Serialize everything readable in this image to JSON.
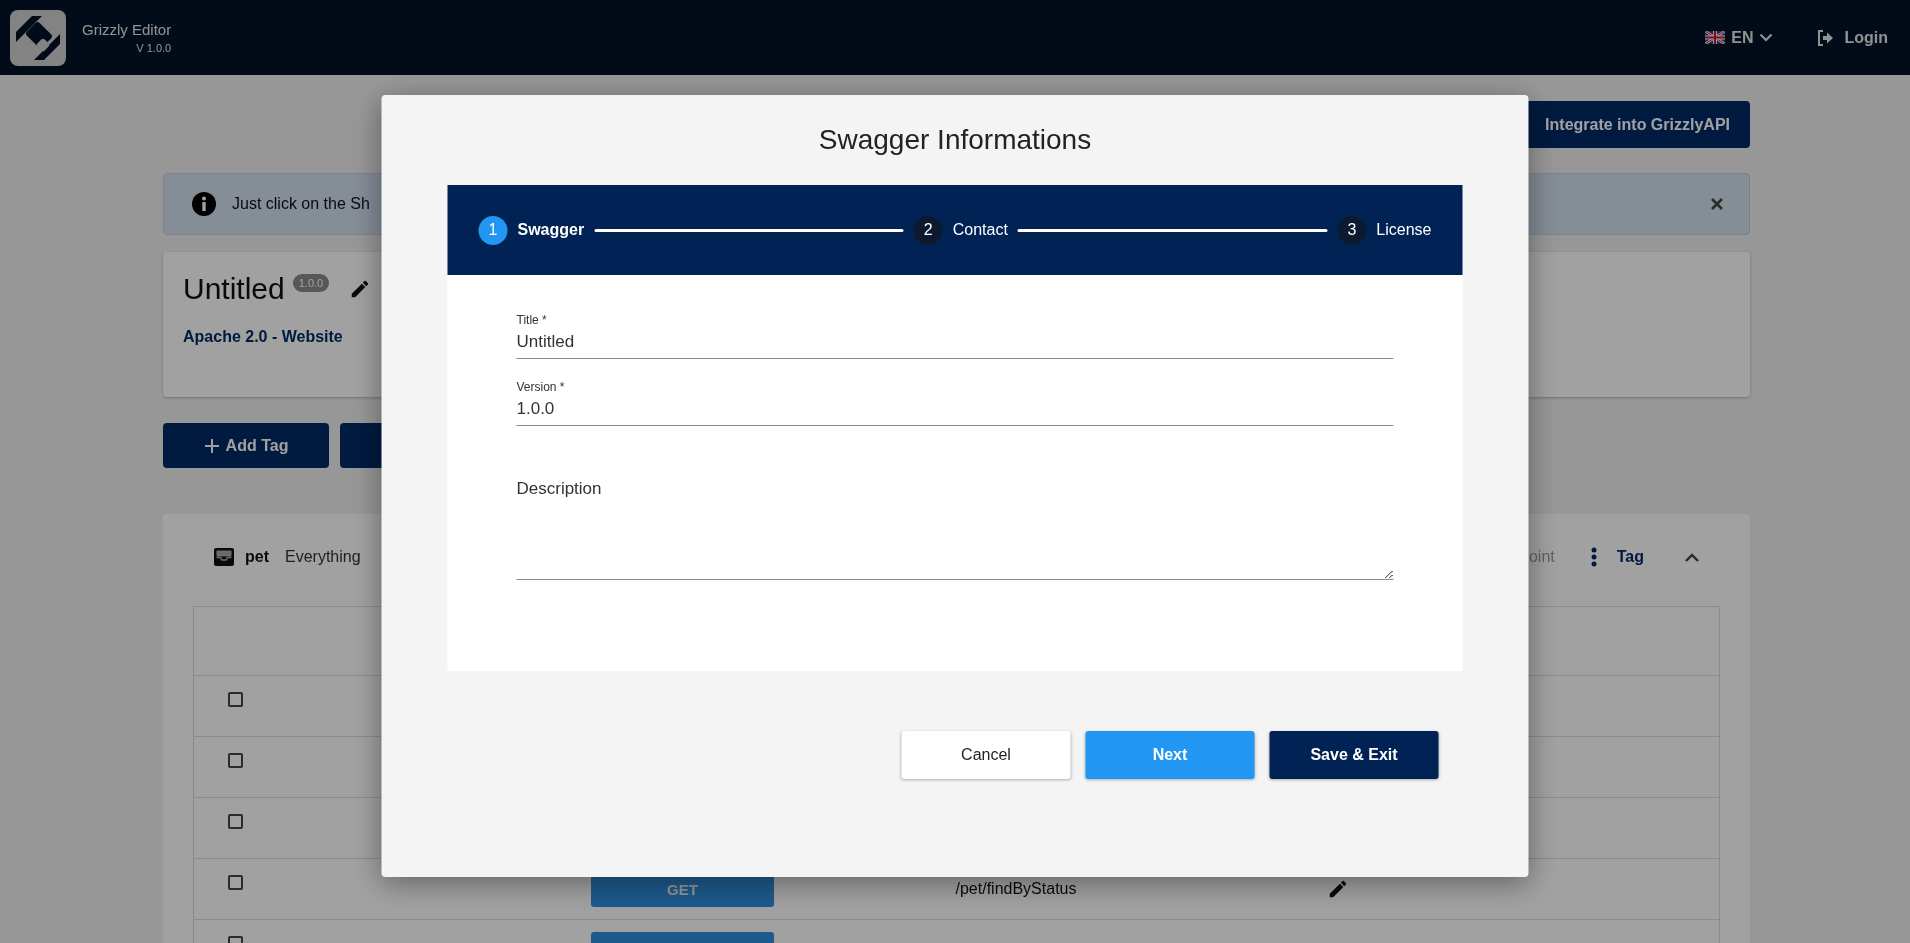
{
  "header": {
    "app_name": "Grizzly Editor",
    "version": "V 1.0.0",
    "language": "EN",
    "login": "Login"
  },
  "page": {
    "integrate_button": "Integrate into GrizzlyAPI",
    "alert": {
      "text": "Just click on the Sh"
    },
    "project": {
      "title": "Untitled",
      "version_badge": "1.0.0",
      "license": "Apache 2.0 - Website"
    },
    "add_tag_button": "Add Tag",
    "tag_panel": {
      "name": "pet",
      "description": "Everything",
      "column_fragment": "oint",
      "tag_button": "Tag",
      "expanded": true,
      "rows": [
        {
          "kind": "plain",
          "checked": false
        },
        {
          "kind": "plain",
          "checked": false
        },
        {
          "kind": "plain",
          "checked": false
        },
        {
          "kind": "endpoint",
          "checked": false,
          "method": "GET",
          "path": "/pet/findByStatus"
        },
        {
          "kind": "cut",
          "checked": false
        }
      ]
    }
  },
  "modal": {
    "title": "Swagger Informations",
    "steps": [
      {
        "number": "1",
        "label": "Swagger",
        "selected": true
      },
      {
        "number": "2",
        "label": "Contact",
        "selected": false
      },
      {
        "number": "3",
        "label": "License",
        "selected": false
      }
    ],
    "fields": [
      {
        "kind": "input",
        "label": "Title *",
        "value": "Untitled"
      },
      {
        "kind": "input",
        "label": "Version *",
        "value": "1.0.0"
      },
      {
        "kind": "textarea",
        "placeholder": "Description"
      }
    ],
    "buttons": [
      {
        "kind": "secondary",
        "label": "Cancel"
      },
      {
        "kind": "primary",
        "label": "Next"
      },
      {
        "kind": "dark",
        "label": "Save & Exit"
      }
    ]
  }
}
